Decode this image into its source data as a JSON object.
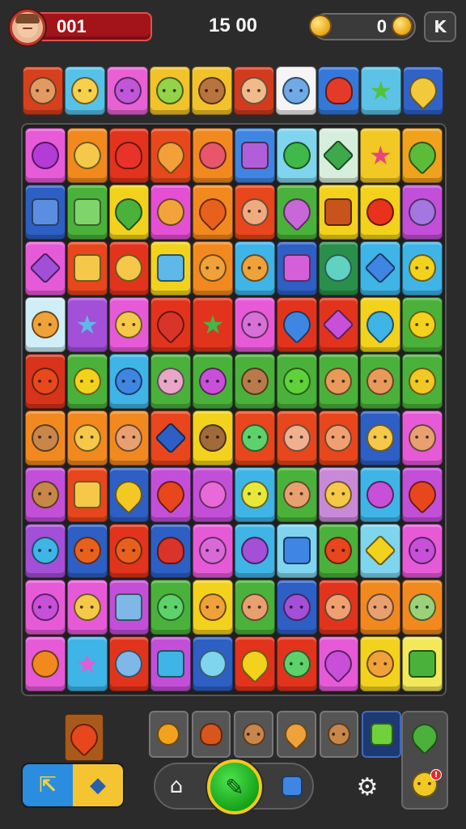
{
  "hud": {
    "level": "001",
    "score": "15 00",
    "coins": "0",
    "menu_glyph": "K",
    "avatar_icon": "player-avatar"
  },
  "goals": [
    {
      "bg": "#d7401c",
      "fg": "#e39a61",
      "shape": "face",
      "icon": "cat-face-icon"
    },
    {
      "bg": "#56c2e8",
      "fg": "#f6d04a",
      "shape": "face",
      "icon": "smile-face-icon"
    },
    {
      "bg": "#e761d4",
      "fg": "#c057d8",
      "shape": "face",
      "icon": "devil-face-icon"
    },
    {
      "bg": "#f1c22a",
      "fg": "#94d248",
      "shape": "face",
      "icon": "green-cat-icon"
    },
    {
      "bg": "#f1c22a",
      "fg": "#b8743d",
      "shape": "face",
      "icon": "boy-face-icon"
    },
    {
      "bg": "#d33b1f",
      "fg": "#f0ba8a",
      "shape": "face",
      "icon": "girl-face-icon"
    },
    {
      "bg": "#f5f5f5",
      "fg": "#6fa9e6",
      "shape": "face",
      "icon": "ghost-face-icon"
    },
    {
      "bg": "#3478d9",
      "fg": "#e33a2a",
      "shape": "heart",
      "icon": "apple-icon"
    },
    {
      "bg": "#5cc2e6",
      "fg": "#52c23a",
      "shape": "star",
      "icon": "leaf-star-icon"
    },
    {
      "bg": "#3062c8",
      "fg": "#f2c93a",
      "shape": "drop",
      "icon": "carrot-icon"
    }
  ],
  "board": [
    [
      {
        "bg": "#e75ad8",
        "fg": "#b43bd6",
        "shape": "round",
        "icon": "grape-icon"
      },
      {
        "bg": "#f2891f",
        "fg": "#f5c84a",
        "shape": "round",
        "icon": "bell-pepper-icon"
      },
      {
        "bg": "#e2341c",
        "fg": "#e8322a",
        "shape": "heart",
        "icon": "cherry-icon"
      },
      {
        "bg": "#e8491c",
        "fg": "#f3a03a",
        "shape": "drop",
        "icon": "carrot-icon"
      },
      {
        "bg": "#f2891f",
        "fg": "#e8566a",
        "shape": "round",
        "icon": "rose-icon"
      },
      {
        "bg": "#3f86e3",
        "fg": "#b05fd8",
        "shape": "square",
        "icon": "jar-icon"
      },
      {
        "bg": "#7fd4ee",
        "fg": "#3fb94a",
        "shape": "round",
        "icon": "ball-icon"
      },
      {
        "bg": "#d8eedc",
        "fg": "#3da94a",
        "shape": "gem",
        "icon": "leaf-icon"
      },
      {
        "bg": "#f2c824",
        "fg": "#e8467a",
        "shape": "star",
        "icon": "star-icon"
      },
      {
        "bg": "#f0a21c",
        "fg": "#5cbc3a",
        "shape": "drop",
        "icon": "pepper-icon"
      }
    ],
    [
      {
        "bg": "#2d5fc4",
        "fg": "#5b8ee0",
        "shape": "square",
        "icon": "crystal-icon"
      },
      {
        "bg": "#4ab23a",
        "fg": "#7fd46a",
        "shape": "square",
        "icon": "cup-icon"
      },
      {
        "bg": "#f2d21c",
        "fg": "#4ab23a",
        "shape": "drop",
        "icon": "pear-icon"
      },
      {
        "bg": "#e44fd4",
        "fg": "#f2a43a",
        "shape": "round",
        "icon": "croissant-icon"
      },
      {
        "bg": "#f2891f",
        "fg": "#e8611c",
        "shape": "drop",
        "icon": "orange-leaf-icon"
      },
      {
        "bg": "#e8461c",
        "fg": "#f0aa80",
        "shape": "face",
        "icon": "kid-face-icon"
      },
      {
        "bg": "#4ab23a",
        "fg": "#c867d8",
        "shape": "drop",
        "icon": "popsicle-icon"
      },
      {
        "bg": "#f2d21c",
        "fg": "#c8541c",
        "shape": "square",
        "icon": "cake-icon"
      },
      {
        "bg": "#f2d21c",
        "fg": "#e8321c",
        "shape": "round",
        "icon": "lollipop-icon"
      },
      {
        "bg": "#c34fd8",
        "fg": "#a476e0",
        "shape": "round",
        "icon": "hat-icon"
      }
    ],
    [
      {
        "bg": "#e65ad8",
        "fg": "#a24fd8",
        "shape": "gem",
        "icon": "amethyst-icon"
      },
      {
        "bg": "#e8461c",
        "fg": "#f5c84a",
        "shape": "square",
        "icon": "house-icon"
      },
      {
        "bg": "#e2341c",
        "fg": "#f5c84a",
        "shape": "round",
        "icon": "shell-icon"
      },
      {
        "bg": "#f2d21c",
        "fg": "#5eb8e8",
        "shape": "square",
        "icon": "jar-icon"
      },
      {
        "bg": "#f2891f",
        "fg": "#f0a23a",
        "shape": "face",
        "icon": "pumpkin-face-icon"
      },
      {
        "bg": "#3fb4e6",
        "fg": "#f0a23a",
        "shape": "face",
        "icon": "peach-face-icon"
      },
      {
        "bg": "#2d5fc4",
        "fg": "#d55fd8",
        "shape": "square",
        "icon": "glove-icon"
      },
      {
        "bg": "#2a8f4a",
        "fg": "#5fd2c2",
        "shape": "round",
        "icon": "egg-icon"
      },
      {
        "bg": "#3fb4e6",
        "fg": "#3f86e3",
        "shape": "gem",
        "icon": "puzzle-icon"
      },
      {
        "bg": "#3fb4e6",
        "fg": "#f2d21c",
        "shape": "face",
        "icon": "lemon-face-icon"
      }
    ],
    [
      {
        "bg": "#cfeef7",
        "fg": "#f0a23a",
        "shape": "face",
        "icon": "onion-face-icon"
      },
      {
        "bg": "#a34fd8",
        "fg": "#5eb8e8",
        "shape": "star",
        "icon": "bow-icon"
      },
      {
        "bg": "#e65ad8",
        "fg": "#f5c84a",
        "shape": "face",
        "icon": "yellow-face-icon"
      },
      {
        "bg": "#e2341c",
        "fg": "#d8342a",
        "shape": "drop",
        "icon": "strawberry-icon"
      },
      {
        "bg": "#e2341c",
        "fg": "#3fb94a",
        "shape": "star",
        "icon": "clover-icon"
      },
      {
        "bg": "#e65ad8",
        "fg": "#d870d8",
        "shape": "face",
        "icon": "pink-face-icon"
      },
      {
        "bg": "#e2341c",
        "fg": "#3f86e3",
        "shape": "drop",
        "icon": "candy-icon"
      },
      {
        "bg": "#e2341c",
        "fg": "#c84fd8",
        "shape": "gem",
        "icon": "ruby-icon"
      },
      {
        "bg": "#f2d21c",
        "fg": "#3fb4e6",
        "shape": "drop",
        "icon": "cream-icon"
      },
      {
        "bg": "#4ab23a",
        "fg": "#f2d21c",
        "shape": "face",
        "icon": "alien-face-icon"
      }
    ],
    [
      {
        "bg": "#d8341c",
        "fg": "#e8491c",
        "shape": "face",
        "icon": "fox-face-icon"
      },
      {
        "bg": "#4ab23a",
        "fg": "#f2d21c",
        "shape": "face",
        "icon": "cat-face-icon"
      },
      {
        "bg": "#3fb4e6",
        "fg": "#3f86e3",
        "shape": "face",
        "icon": "drop-face-icon"
      },
      {
        "bg": "#4ab23a",
        "fg": "#e8a6c8",
        "shape": "face",
        "icon": "bean-face-icon"
      },
      {
        "bg": "#4ab23a",
        "fg": "#c84fd8",
        "shape": "face",
        "icon": "devil-face-icon"
      },
      {
        "bg": "#4ab23a",
        "fg": "#b87a4a",
        "shape": "face",
        "icon": "acorn-face-icon"
      },
      {
        "bg": "#4ab23a",
        "fg": "#5ed23a",
        "shape": "face",
        "icon": "pea-face-icon"
      },
      {
        "bg": "#4ab23a",
        "fg": "#e89a5a",
        "shape": "face",
        "icon": "fox-face-icon"
      },
      {
        "bg": "#4ab23a",
        "fg": "#e89a5a",
        "shape": "face",
        "icon": "cat-face-icon"
      },
      {
        "bg": "#4ab23a",
        "fg": "#f2c824",
        "shape": "face",
        "icon": "pikachu-face-icon"
      }
    ],
    [
      {
        "bg": "#f2891f",
        "fg": "#c8864a",
        "shape": "face",
        "icon": "boy-face-icon"
      },
      {
        "bg": "#f2891f",
        "fg": "#f5c84a",
        "shape": "face",
        "icon": "lion-face-icon"
      },
      {
        "bg": "#f2891f",
        "fg": "#e8a070",
        "shape": "face",
        "icon": "elf-face-icon"
      },
      {
        "bg": "#e8461c",
        "fg": "#2d5fc4",
        "shape": "gem",
        "icon": "rocket-icon"
      },
      {
        "bg": "#f2d21c",
        "fg": "#a06a3a",
        "shape": "face",
        "icon": "potato-face-icon"
      },
      {
        "bg": "#e8461c",
        "fg": "#5ed26a",
        "shape": "face",
        "icon": "frog-face-icon"
      },
      {
        "bg": "#e8461c",
        "fg": "#f0b090",
        "shape": "face",
        "icon": "chef-face-icon"
      },
      {
        "bg": "#e8461c",
        "fg": "#f0a070",
        "shape": "face",
        "icon": "fox-face-icon"
      },
      {
        "bg": "#2d5fc4",
        "fg": "#f5c84a",
        "shape": "face",
        "icon": "baby-face-icon"
      },
      {
        "bg": "#e65ad8",
        "fg": "#e8a070",
        "shape": "face",
        "icon": "cup-face-icon"
      }
    ],
    [
      {
        "bg": "#c34fd8",
        "fg": "#c8864a",
        "shape": "face",
        "icon": "monkey-face-icon"
      },
      {
        "bg": "#e8461c",
        "fg": "#f5c84a",
        "shape": "square",
        "icon": "gift-icon"
      },
      {
        "bg": "#2d5fc4",
        "fg": "#f2c824",
        "shape": "drop",
        "icon": "balloon-icon"
      },
      {
        "bg": "#c34fd8",
        "fg": "#e8461c",
        "shape": "drop",
        "icon": "carrot-icon"
      },
      {
        "bg": "#c34fd8",
        "fg": "#e86ad8",
        "shape": "round",
        "icon": "plum-icon"
      },
      {
        "bg": "#3fb4e6",
        "fg": "#e8e83a",
        "shape": "face",
        "icon": "lime-face-icon"
      },
      {
        "bg": "#4ab23a",
        "fg": "#e8a070",
        "shape": "face",
        "icon": "girl-face-icon"
      },
      {
        "bg": "#c88ad8",
        "fg": "#f5c84a",
        "shape": "face",
        "icon": "fox-face-icon"
      },
      {
        "bg": "#3fb4e6",
        "fg": "#c84fd8",
        "shape": "round",
        "icon": "swirl-icon"
      },
      {
        "bg": "#c34fd8",
        "fg": "#e8461c",
        "shape": "drop",
        "icon": "tag-icon"
      }
    ],
    [
      {
        "bg": "#a34fd8",
        "fg": "#3fb4e6",
        "shape": "face",
        "icon": "bird-face-icon"
      },
      {
        "bg": "#2d5fc4",
        "fg": "#e8611c",
        "shape": "face",
        "icon": "fox-face-icon"
      },
      {
        "bg": "#e2341c",
        "fg": "#e8611c",
        "shape": "face",
        "icon": "orange-face-icon"
      },
      {
        "bg": "#2d5fc4",
        "fg": "#d8342a",
        "shape": "heart",
        "icon": "berry-icon"
      },
      {
        "bg": "#e65ad8",
        "fg": "#d86ad8",
        "shape": "face",
        "icon": "onion-face-icon"
      },
      {
        "bg": "#3fb4e6",
        "fg": "#a34fd8",
        "shape": "round",
        "icon": "leaf-icon"
      },
      {
        "bg": "#7fd4ee",
        "fg": "#3f86e3",
        "shape": "square",
        "icon": "cassette-icon"
      },
      {
        "bg": "#4ab23a",
        "fg": "#e8461c",
        "shape": "face",
        "icon": "tomato-face-icon"
      },
      {
        "bg": "#7fd4ee",
        "fg": "#f2d21c",
        "shape": "gem",
        "icon": "cheese-icon"
      },
      {
        "bg": "#e65ad8",
        "fg": "#c84fd8",
        "shape": "face",
        "icon": "blob-face-icon"
      }
    ],
    [
      {
        "bg": "#e65ad8",
        "fg": "#c84fd8",
        "shape": "face",
        "icon": "grumpy-face-icon"
      },
      {
        "bg": "#e65ad8",
        "fg": "#f5c84a",
        "shape": "face",
        "icon": "smile-face-icon"
      },
      {
        "bg": "#c34fd8",
        "fg": "#7fb8e6",
        "shape": "square",
        "icon": "robot-icon"
      },
      {
        "bg": "#4ab23a",
        "fg": "#5ed26a",
        "shape": "face",
        "icon": "green-face-icon"
      },
      {
        "bg": "#f2d21c",
        "fg": "#f0a23a",
        "shape": "face",
        "icon": "carrot-face-icon"
      },
      {
        "bg": "#4ab23a",
        "fg": "#e8a070",
        "shape": "face",
        "icon": "girl-face-icon"
      },
      {
        "bg": "#2d5fc4",
        "fg": "#a34fd8",
        "shape": "face",
        "icon": "eggplant-face-icon"
      },
      {
        "bg": "#e2341c",
        "fg": "#f0a070",
        "shape": "face",
        "icon": "turnip-face-icon"
      },
      {
        "bg": "#f2891f",
        "fg": "#e8a070",
        "shape": "face",
        "icon": "cat-face-icon"
      },
      {
        "bg": "#f2891f",
        "fg": "#9ad27a",
        "shape": "face",
        "icon": "zombie-face-icon"
      }
    ],
    [
      {
        "bg": "#e65ad8",
        "fg": "#f2891f",
        "shape": "round",
        "icon": "basketball-icon"
      },
      {
        "bg": "#3fb4e6",
        "fg": "#e65ad8",
        "shape": "star",
        "icon": "bolt-icon"
      },
      {
        "bg": "#e2341c",
        "fg": "#7fb8e6",
        "shape": "round",
        "icon": "globe-icon"
      },
      {
        "bg": "#c34fd8",
        "fg": "#3fb4e6",
        "shape": "square",
        "icon": "burger-icon"
      },
      {
        "bg": "#2d5fc4",
        "fg": "#7fd4ee",
        "shape": "round",
        "icon": "magnifier-icon"
      },
      {
        "bg": "#e2341c",
        "fg": "#f2d21c",
        "shape": "drop",
        "icon": "bell-icon"
      },
      {
        "bg": "#e2341c",
        "fg": "#5ed26a",
        "shape": "face",
        "icon": "frog-face-icon"
      },
      {
        "bg": "#e65ad8",
        "fg": "#c84fd8",
        "shape": "drop",
        "icon": "shoe-icon"
      },
      {
        "bg": "#f2d21c",
        "fg": "#f0a23a",
        "shape": "face",
        "icon": "sun-face-icon"
      },
      {
        "bg": "#f2e85a",
        "fg": "#4ab23a",
        "shape": "square",
        "icon": "box-icon"
      }
    ]
  ],
  "bottom": {
    "held_tile": {
      "bg": "#a85a1a",
      "fg": "#e8461c",
      "shape": "drop",
      "icon": "chili-icon"
    },
    "swap_left_glyph": "⇱",
    "swap_right_glyph": "◆",
    "slots": [
      {
        "fg": "#f2a21c",
        "shape": "round",
        "icon": "orange-icon",
        "active": false
      },
      {
        "fg": "#d8561c",
        "shape": "heart",
        "icon": "squirrel-icon",
        "active": false
      },
      {
        "fg": "#c8864a",
        "shape": "face",
        "icon": "boy-face-icon",
        "active": false
      },
      {
        "fg": "#f0a23a",
        "shape": "drop",
        "icon": "onion-icon",
        "active": false
      },
      {
        "fg": "#c8864a",
        "shape": "face",
        "icon": "boy-face-icon",
        "active": false
      },
      {
        "fg": "#6fd23a",
        "shape": "square",
        "icon": "cup-icon",
        "active": true
      }
    ],
    "side_top": {
      "fg": "#4ab23a",
      "shape": "drop",
      "icon": "pickle-icon"
    },
    "side_bottom": {
      "fg": "#f2c824",
      "shape": "face",
      "icon": "chick-face-icon"
    },
    "badge_text": "!",
    "home_glyph": "⌂",
    "play_glyph": "✎",
    "settings_glyph": "⚙"
  }
}
